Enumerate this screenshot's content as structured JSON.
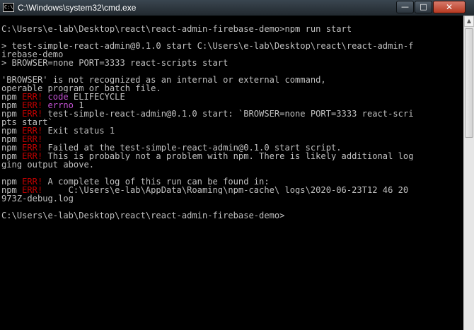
{
  "window": {
    "title": "C:\\Windows\\system32\\cmd.exe",
    "icon_text": "C:\\",
    "controls": {
      "minimize": "—",
      "maximize": "□",
      "close": "✕"
    }
  },
  "terminal": {
    "lines": [
      [
        {
          "t": "C:\\Users\\e-lab\\Desktop\\react\\react-admin-firebase-demo>npm run start"
        }
      ],
      [
        {
          "t": ""
        }
      ],
      [
        {
          "t": "> test-simple-react-admin@0.1.0 start C:\\Users\\e-lab\\Desktop\\react\\react-admin-f"
        }
      ],
      [
        {
          "t": "irebase-demo"
        }
      ],
      [
        {
          "t": "> BROWSER=none PORT=3333 react-scripts start"
        }
      ],
      [
        {
          "t": ""
        }
      ],
      [
        {
          "t": "'BROWSER' is not recognized as an internal or external command,"
        }
      ],
      [
        {
          "t": "operable program or batch file."
        }
      ],
      [
        {
          "t": "npm "
        },
        {
          "t": "ERR!",
          "c": "red"
        },
        {
          "t": " "
        },
        {
          "t": "code",
          "c": "purple"
        },
        {
          "t": " ELIFECYCLE"
        }
      ],
      [
        {
          "t": "npm "
        },
        {
          "t": "ERR!",
          "c": "red"
        },
        {
          "t": " "
        },
        {
          "t": "errno",
          "c": "purple"
        },
        {
          "t": " 1"
        }
      ],
      [
        {
          "t": "npm "
        },
        {
          "t": "ERR!",
          "c": "red"
        },
        {
          "t": " test-simple-react-admin@0.1.0 start: `BROWSER=none PORT=3333 react-scri"
        }
      ],
      [
        {
          "t": "pts start`"
        }
      ],
      [
        {
          "t": "npm "
        },
        {
          "t": "ERR!",
          "c": "red"
        },
        {
          "t": " Exit status 1"
        }
      ],
      [
        {
          "t": "npm "
        },
        {
          "t": "ERR!",
          "c": "red"
        }
      ],
      [
        {
          "t": "npm "
        },
        {
          "t": "ERR!",
          "c": "red"
        },
        {
          "t": " Failed at the test-simple-react-admin@0.1.0 start script."
        }
      ],
      [
        {
          "t": "npm "
        },
        {
          "t": "ERR!",
          "c": "red"
        },
        {
          "t": " This is probably not a problem with npm. There is likely additional log"
        }
      ],
      [
        {
          "t": "ging output above."
        }
      ],
      [
        {
          "t": ""
        }
      ],
      [
        {
          "t": "npm "
        },
        {
          "t": "ERR!",
          "c": "red"
        },
        {
          "t": " A complete log of this run can be found in:"
        }
      ],
      [
        {
          "t": "npm "
        },
        {
          "t": "ERR!",
          "c": "red"
        },
        {
          "t": "     C:\\Users\\e-lab\\AppData\\Roaming\\npm-cache\\_logs\\2020-06-23T12_46_20_"
        }
      ],
      [
        {
          "t": "973Z-debug.log"
        }
      ],
      [
        {
          "t": ""
        }
      ],
      [
        {
          "t": "C:\\Users\\e-lab\\Desktop\\react\\react-admin-firebase-demo>"
        }
      ]
    ]
  },
  "scrollbar": {
    "up_arrow": "▲"
  },
  "colors": {
    "background": "#000000",
    "text": "#c0c0c0",
    "err": "#c00000",
    "keyword": "#c050d0"
  }
}
